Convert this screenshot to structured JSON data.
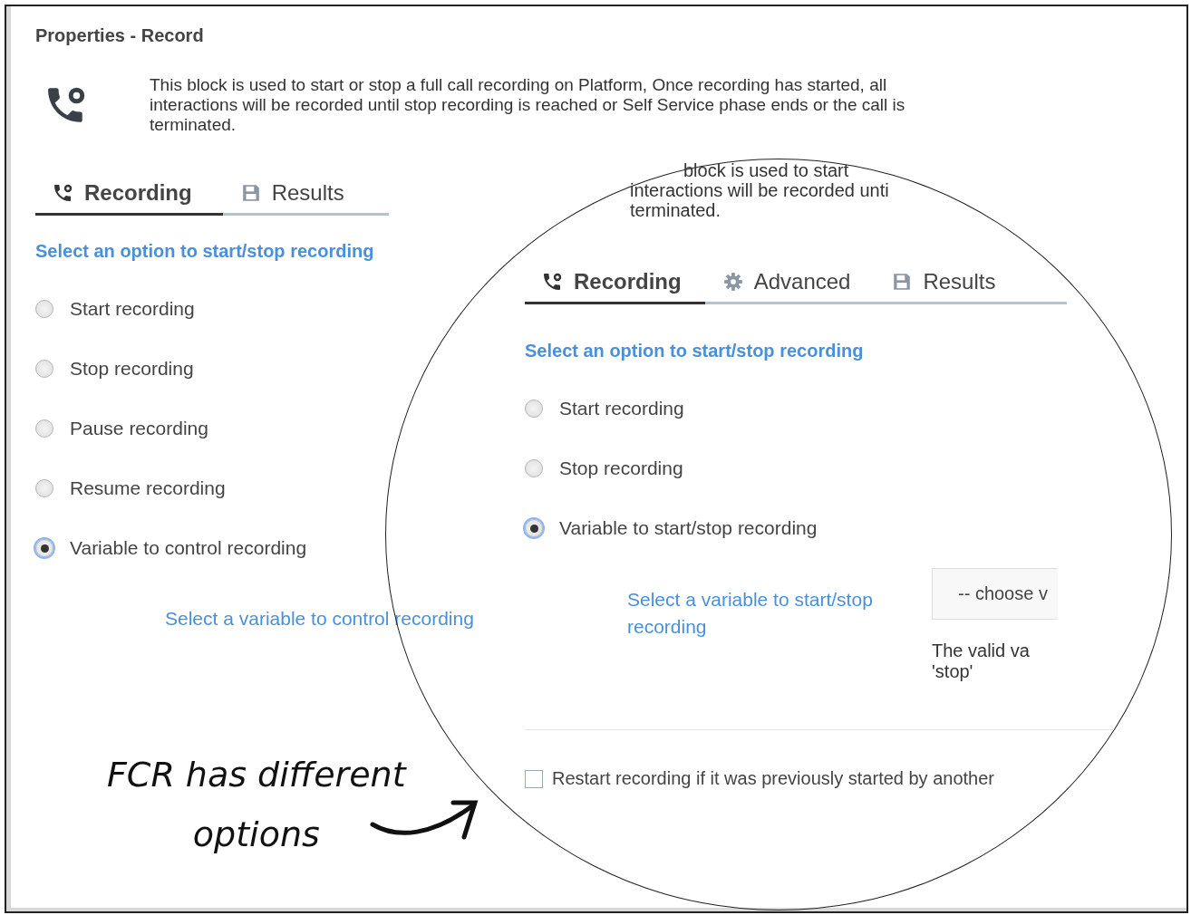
{
  "panel": {
    "title": "Properties - Record",
    "description": "This block is used to start or stop a full call recording on Platform, Once recording has started, all interactions will be recorded until stop recording is reached or Self Service phase ends or the call is terminated.",
    "tabs": [
      {
        "label": "Recording",
        "kind": "phone",
        "selected": true
      },
      {
        "label": "Results",
        "kind": "save",
        "selected": false
      }
    ],
    "heading": "Select an option to start/stop recording",
    "options": [
      {
        "label": "Start recording",
        "selected": false
      },
      {
        "label": "Stop recording",
        "selected": false
      },
      {
        "label": "Pause recording",
        "selected": false
      },
      {
        "label": "Resume recording",
        "selected": false
      },
      {
        "label": "Variable to control recording",
        "selected": true
      }
    ],
    "variable_label": "Select a variable to control recording"
  },
  "magnifier": {
    "description_lines": [
      "block is used to start",
      "interactions will be recorded unti",
      "terminated."
    ],
    "tabs": [
      {
        "label": "Recording",
        "kind": "phone",
        "selected": true
      },
      {
        "label": "Advanced",
        "kind": "gear",
        "selected": false
      },
      {
        "label": "Results",
        "kind": "save",
        "selected": false
      }
    ],
    "heading": "Select an option to start/stop recording",
    "options": [
      {
        "label": "Start recording",
        "selected": false
      },
      {
        "label": "Stop recording",
        "selected": false
      },
      {
        "label": "Variable to start/stop recording",
        "selected": true
      }
    ],
    "variable_label": "Select a variable to start/stop recording",
    "dropdown": {
      "value": "-- choose v"
    },
    "hint_lines": [
      "The valid va",
      "'stop'"
    ],
    "restart": {
      "label": "Restart recording if it was previously started by another",
      "checked": false
    }
  },
  "annotation": {
    "lines": [
      "FCR has different",
      "options"
    ]
  }
}
